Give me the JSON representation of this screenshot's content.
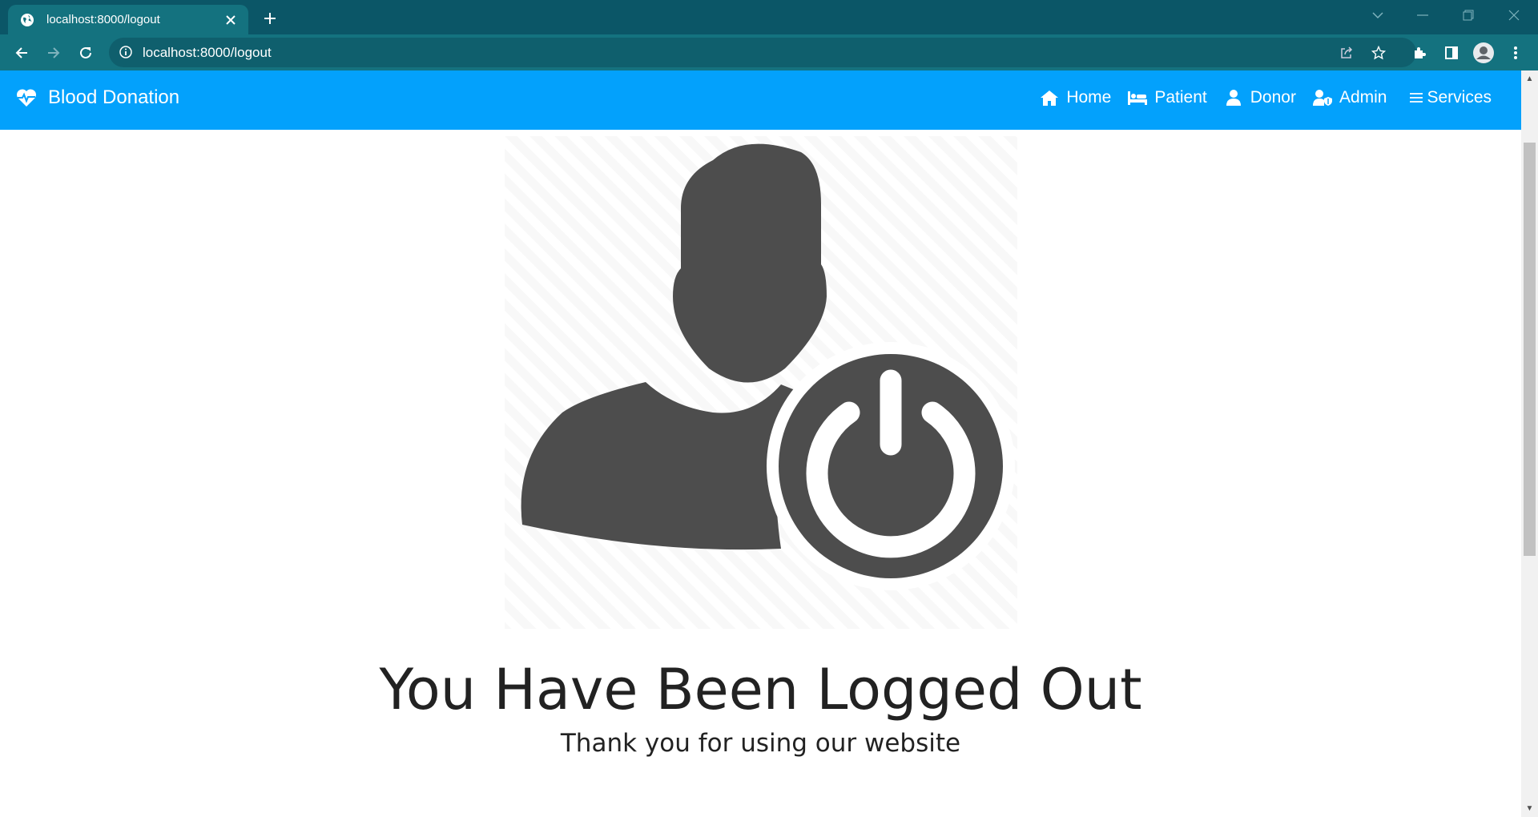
{
  "browser": {
    "tab_title": "localhost:8000/logout",
    "url": "localhost:8000/logout",
    "theme_color": "#0b5667"
  },
  "navbar": {
    "brand": "Blood Donation",
    "background": "#03a1fc",
    "links": [
      {
        "label": "Home",
        "icon": "home-icon"
      },
      {
        "label": "Patient",
        "icon": "bed-icon"
      },
      {
        "label": "Donor",
        "icon": "user-icon"
      },
      {
        "label": "Admin",
        "icon": "user-shield-icon"
      },
      {
        "label": "Services",
        "icon": "menu-icon"
      }
    ]
  },
  "main": {
    "figure_icon": "user-logout-icon",
    "title": "You Have Been Logged Out",
    "subtitle": "Thank you for using our website"
  }
}
